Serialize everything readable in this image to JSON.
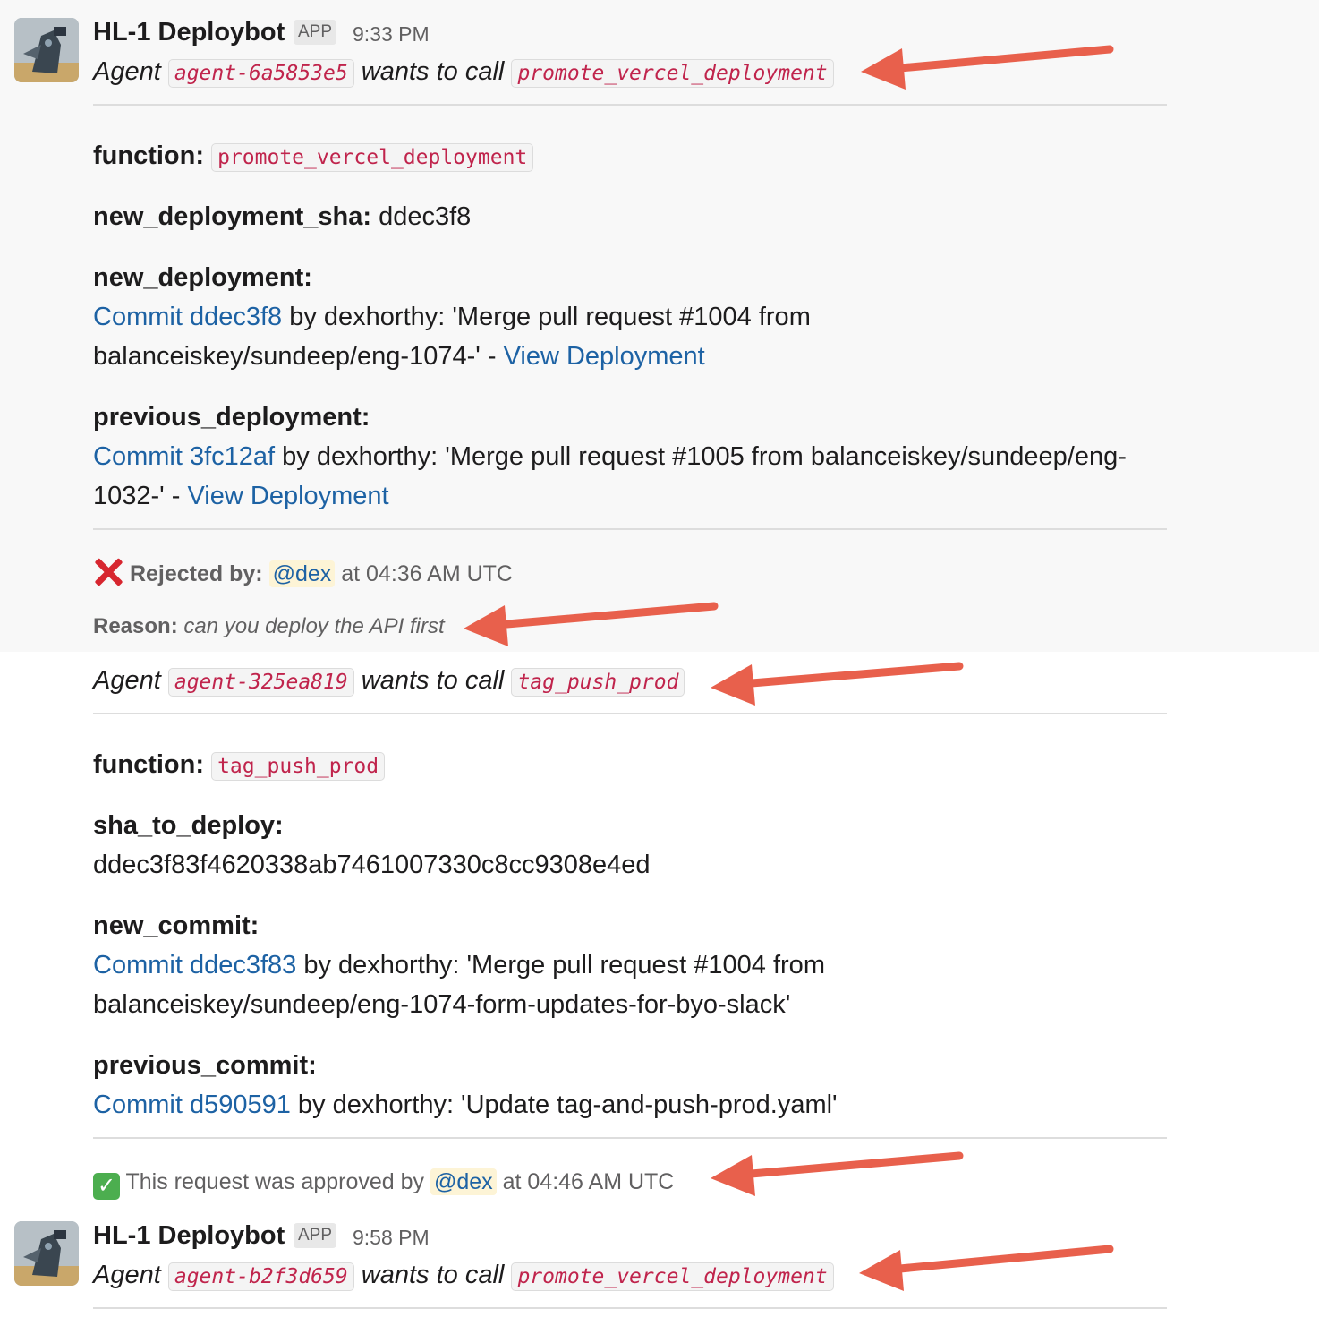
{
  "bot": {
    "name": "HL-1 Deploybot",
    "badge": "APP"
  },
  "messages": [
    {
      "time": "9:33 PM",
      "header": {
        "agent_word": "Agent",
        "agent_id": "agent-6a5853e5",
        "wants_to_call": "wants to call",
        "function": "promote_vercel_deployment"
      },
      "function_label": "function:",
      "function_value": "promote_vercel_deployment",
      "sha_label": "new_deployment_sha:",
      "sha_value": "ddec3f8",
      "new_label": "new_deployment:",
      "new_commit_link": "Commit ddec3f8",
      "new_text_1": " by dexhorthy: 'Merge pull request #1004 from",
      "new_text_2": "balanceiskey/sundeep/eng-1074-' - ",
      "new_view_link": "View Deployment",
      "prev_label": "previous_deployment:",
      "prev_commit_link": "Commit 3fc12af",
      "prev_text_1": " by dexhorthy: 'Merge pull request #1005 from balanceiskey/sundeep/eng-",
      "prev_text_2": "1032-' - ",
      "prev_view_link": "View Deployment",
      "status": {
        "label": "Rejected by:",
        "mention": "@dex",
        "time": "at 04:36 AM UTC"
      },
      "reason": {
        "label": "Reason:",
        "text": "can you deploy the API first"
      }
    },
    {
      "header": {
        "agent_word": "Agent",
        "agent_id": "agent-325ea819",
        "wants_to_call": "wants to call",
        "function": "tag_push_prod"
      },
      "function_label": "function:",
      "function_value": "tag_push_prod",
      "sha_label": "sha_to_deploy:",
      "sha_value": "ddec3f83f4620338ab7461007330c8cc9308e4ed",
      "new_label": "new_commit:",
      "new_commit_link": "Commit ddec3f83",
      "new_text_1": " by dexhorthy: 'Merge pull request #1004 from",
      "new_text_2": "balanceiskey/sundeep/eng-1074-form-updates-for-byo-slack'",
      "prev_label": "previous_commit:",
      "prev_commit_link": "Commit d590591",
      "prev_text_1": " by dexhorthy: 'Update tag-and-push-prod.yaml'",
      "status": {
        "icon": "check-mark-icon",
        "text": "This request was approved by",
        "mention": "@dex",
        "time": "at 04:46 AM UTC"
      }
    },
    {
      "time": "9:58 PM",
      "header": {
        "agent_word": "Agent",
        "agent_id": "agent-b2f3d659",
        "wants_to_call": "wants to call",
        "function": "promote_vercel_deployment"
      }
    }
  ],
  "colors": {
    "arrow": "#e8604c",
    "link": "#1d62a4",
    "code": "#c0244c",
    "reject": "#d7262f",
    "approve": "#4cae4f"
  }
}
